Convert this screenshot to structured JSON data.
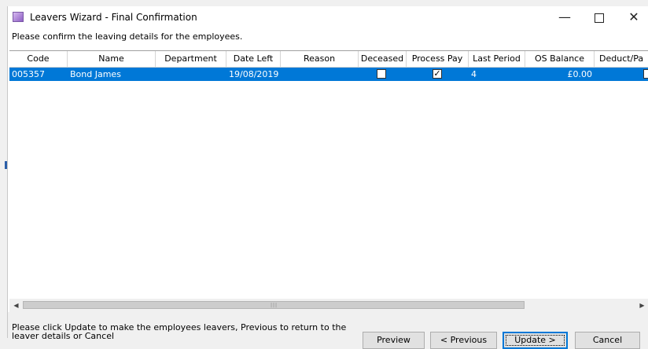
{
  "window": {
    "title": "Leavers Wizard - Final Confirmation",
    "minimize_glyph": "—",
    "close_glyph": "✕",
    "instruction": "Please confirm the leaving details for the employees."
  },
  "grid": {
    "columns": [
      "Code",
      "Name",
      "Department",
      "Date Left",
      "Reason",
      "Deceased",
      "Process Pay",
      "Last Period",
      "OS Balance",
      "Deduct/Pa"
    ],
    "rows": [
      {
        "code": "005357",
        "name": "Bond James",
        "department": "",
        "date_left": "19/08/2019",
        "reason": "",
        "deceased": false,
        "process_pay": true,
        "last_period": "4",
        "os_balance": "£0.00",
        "deduct_pay": false,
        "selected": true
      }
    ],
    "selection_color": "#0078d7"
  },
  "scrollbar": {
    "left_arrow": "◀",
    "right_arrow": "▶",
    "grip": "|||"
  },
  "footer": {
    "message": "Please click Update to make the employees leavers, Previous to return to the leaver details or Cancel",
    "buttons": {
      "preview": "Preview",
      "previous": "< Previous",
      "update": "Update >",
      "cancel": "Cancel"
    }
  },
  "icons": {
    "app": "wizard-app-icon",
    "minimize": "minimize-icon",
    "maximize": "maximize-icon",
    "close": "close-icon"
  }
}
